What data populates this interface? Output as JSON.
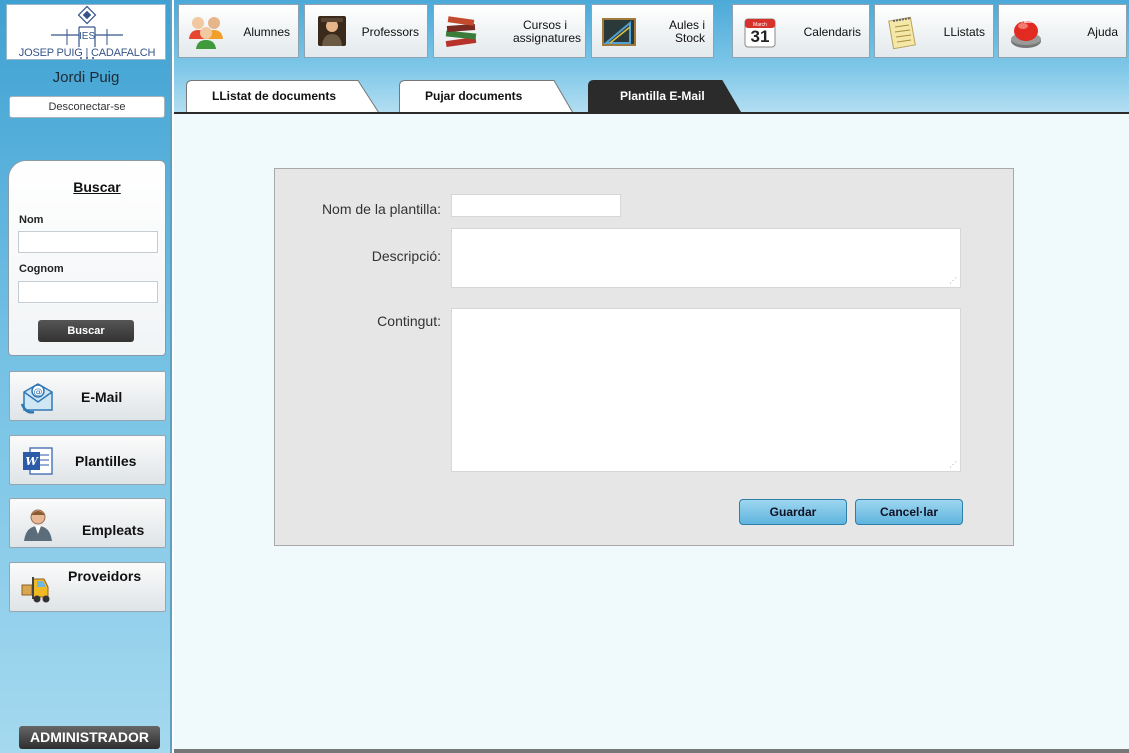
{
  "school": {
    "logo_text": "JOSEP PUIG | CADAFALCH",
    "logo_mark": "IES"
  },
  "user": {
    "name": "Jordi Puig",
    "disconnect_label": "Desconectar-se"
  },
  "search": {
    "title": "Buscar",
    "fields": [
      {
        "label": "Nom",
        "value": ""
      },
      {
        "label": "Cognom",
        "value": ""
      }
    ],
    "button_label": "Buscar"
  },
  "sidebar": {
    "items": [
      {
        "label": "E-Mail",
        "icon": "email-icon"
      },
      {
        "label": "Plantilles",
        "icon": "word-document-icon"
      },
      {
        "label": "Empleats",
        "icon": "person-icon"
      },
      {
        "label": "Proveidors",
        "icon": "forklift-icon"
      }
    ],
    "role_badge": "ADMINISTRADOR"
  },
  "nav": {
    "items": [
      {
        "label": "Alumnes",
        "icon": "students-icon"
      },
      {
        "label": "Professors",
        "icon": "teacher-icon"
      },
      {
        "label": "Cursos i assignatures",
        "icon": "books-icon"
      },
      {
        "label": "Aules i Stock",
        "icon": "blackboard-icon"
      },
      {
        "label": "Calendaris",
        "icon": "calendar-icon",
        "calendar_day": "31",
        "calendar_month": "March"
      },
      {
        "label": "LListats",
        "icon": "notepad-icon"
      },
      {
        "label": "Ajuda",
        "icon": "help-button-icon",
        "icon_text": "HELP"
      }
    ]
  },
  "tabs": [
    {
      "label": "LListat de documents",
      "active": false
    },
    {
      "label": "Pujar documents",
      "active": false
    },
    {
      "label": "Plantilla E-Mail",
      "active": true
    }
  ],
  "form": {
    "name_label": "Nom de la plantilla:",
    "name_value": "",
    "description_label": "Descripció:",
    "description_value": "",
    "content_label": "Contingut:",
    "content_value": "",
    "save_label": "Guardar",
    "cancel_label": "Cancel·lar"
  },
  "colors": {
    "sidebar_top": "#3fa1d2",
    "accent_button": "#5fb4de",
    "active_tab": "#2b2b2b"
  }
}
